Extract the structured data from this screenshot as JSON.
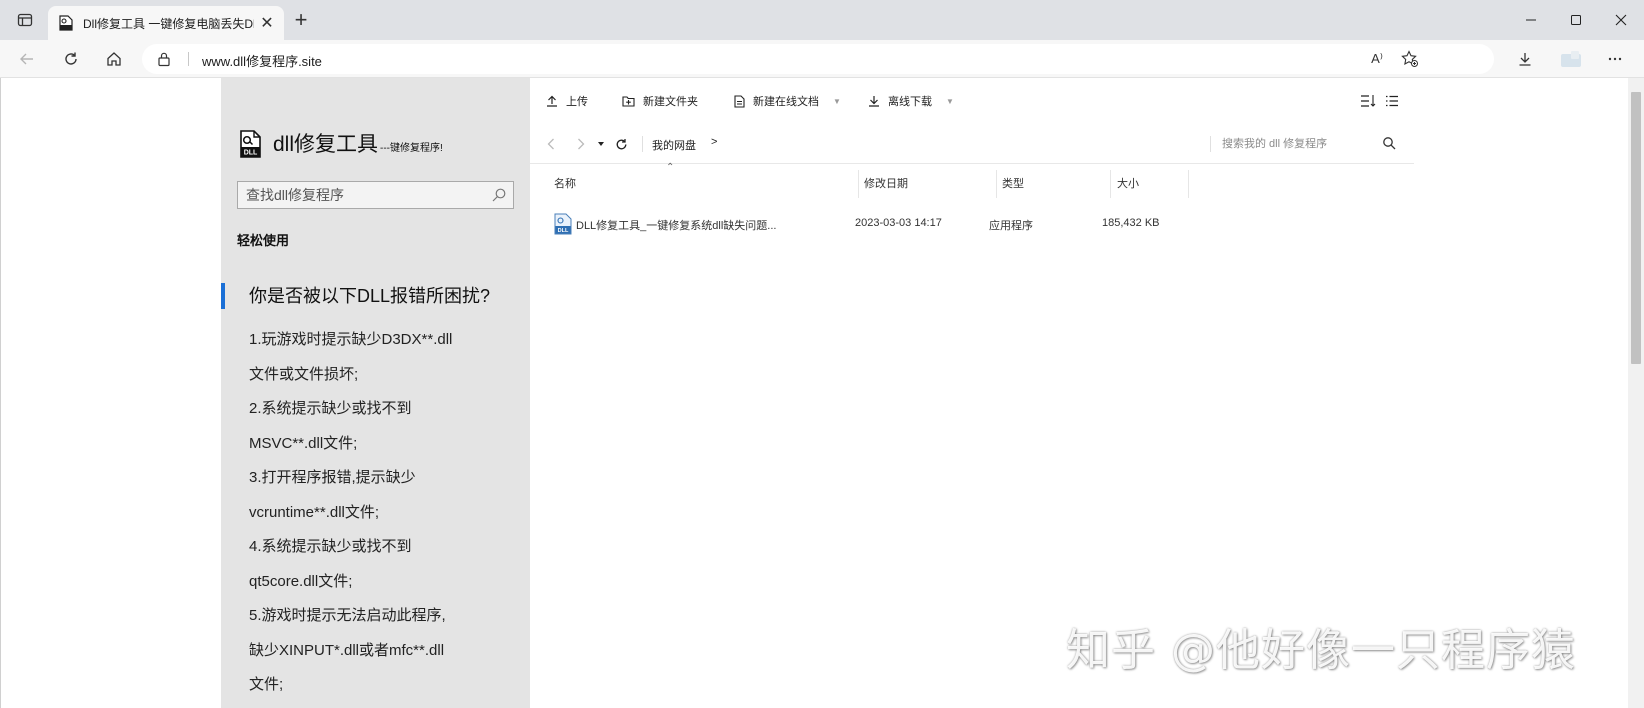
{
  "browser": {
    "tab": {
      "title": "Dll修复工具 一键修复电脑丢失Dl",
      "close": "✕"
    },
    "newtab": "+",
    "address": {
      "url": "www.dll修复程序.site"
    },
    "read_aloud": "A⁾"
  },
  "sidebar": {
    "brand": {
      "name": "dll修复工具",
      "slogan": "---键修复程序!"
    },
    "search": {
      "placeholder": "查找dll修复程序"
    },
    "section_title": "轻松使用",
    "question": "你是否被以下DLL报错所困扰?",
    "lines": [
      "1.玩游戏时提示缺少D3DX**.dll",
      "文件或文件损坏;",
      "2.系统提示缺少或找不到",
      "MSVC**.dll文件;",
      "3.打开程序报错,提示缺少",
      "vcruntime**.dll文件;",
      "4.系统提示缺少或找不到",
      "qt5core.dll文件;",
      "5.游戏时提示无法启动此程序,",
      "缺少XINPUT*.dll或者mfc**.dll",
      "文件;"
    ]
  },
  "filemanager": {
    "toolbar": {
      "upload": "上传",
      "new_folder": "新建文件夹",
      "new_doc": "新建在线文档",
      "offline_download": "离线下载"
    },
    "breadcrumb": {
      "root": "我的网盘",
      "arrow": ">"
    },
    "search": {
      "placeholder": "搜索我的 dll 修复程序"
    },
    "columns": {
      "name": "名称",
      "modified": "修改日期",
      "type": "类型",
      "size": "大小"
    },
    "files": [
      {
        "name": "DLL修复工具_一键修复系统dll缺失问题...",
        "modified": "2023-03-03 14:17",
        "type": "应用程序",
        "size": "185,432 KB"
      }
    ]
  },
  "watermark": "知乎 @他好像一只程序猿",
  "colors": {
    "accent": "#1a6fd6",
    "sidebar_bg": "#e4e4e4",
    "chrome_bg": "#dfe1e5"
  }
}
